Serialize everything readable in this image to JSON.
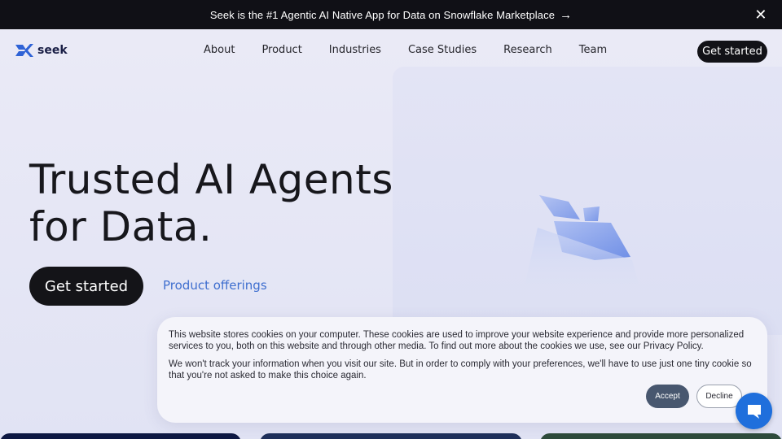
{
  "announcement": {
    "text": "Seek is the #1 Agentic AI Native App for Data on Snowflake Marketplace",
    "arrow": "→",
    "close": "✕"
  },
  "brand": {
    "name": "seek",
    "logo_icon": "seek-logo-icon"
  },
  "nav": {
    "items": [
      "About",
      "Product",
      "Industries",
      "Case Studies",
      "Research",
      "Team"
    ],
    "cta": "Get started"
  },
  "hero": {
    "title_line1": "Trusted AI Agents",
    "title_line2": "for Data.",
    "primary_cta": "Get started",
    "secondary_cta": "Product offerings"
  },
  "cookie_banner": {
    "paragraph1": "This website stores cookies on your computer. These cookies are used to improve your website experience and provide more personalized services to you, both on this website and through other media. To find out more about the cookies we use, see our Privacy Policy.",
    "paragraph2": "We won't track your information when you visit our site. But in order to comply with your preferences, we'll have to use just one tiny cookie so that you're not asked to make this choice again.",
    "accept": "Accept",
    "decline": "Decline"
  },
  "chat": {
    "icon": "chat-bubble-icon"
  },
  "colors": {
    "accent_blue": "#3f6fcf",
    "dark": "#121217",
    "chat_blue": "#1f6fdc",
    "accept_button": "#48576f"
  }
}
